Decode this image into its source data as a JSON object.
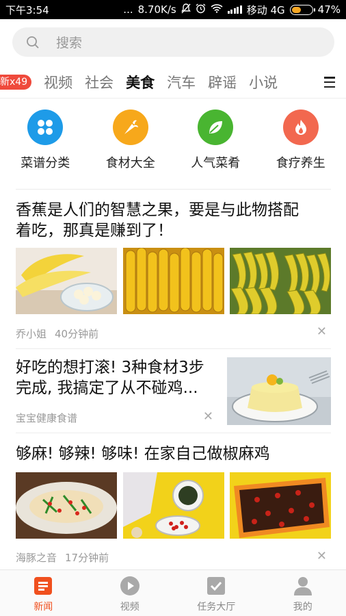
{
  "status_bar": {
    "time": "下午3:54",
    "dots": "...",
    "speed": "8.70K/s",
    "carrier": "移动 4G",
    "battery_text": "47%",
    "battery_level": 0.47
  },
  "search": {
    "placeholder": "搜索"
  },
  "tabs": {
    "badge": "新x49",
    "items": [
      "视频",
      "社会",
      "美食",
      "汽车",
      "辟谣",
      "小说"
    ],
    "active": "美食"
  },
  "categories": [
    {
      "label": "菜谱分类",
      "icon": "clover-icon",
      "color": "#1e9be8"
    },
    {
      "label": "食材大全",
      "icon": "carrot-icon",
      "color": "#f7a81b"
    },
    {
      "label": "人气菜肴",
      "icon": "leaf-icon",
      "color": "#49b531"
    },
    {
      "label": "食疗养生",
      "icon": "flame-icon",
      "color": "#f2684f"
    }
  ],
  "articles": [
    {
      "title_line1": "香蕉是人们的智慧之果，要是与此物搭配",
      "title_line2": "着吃，那真是赚到了！",
      "source": "乔小姐",
      "time": "40分钟前"
    },
    {
      "title_line1": "好吃的想打滚! 3种食材3步",
      "title_line2": "完成, 我搞定了从不碰鸡...",
      "source": "宝宝健康食谱",
      "time": ""
    },
    {
      "title_line1": "够麻! 够辣! 够味! 在家自己做椒麻鸡",
      "source": "海豚之音",
      "time": "17分钟前"
    }
  ],
  "bottom_nav": [
    {
      "label": "新闻",
      "icon": "news-icon",
      "active": true
    },
    {
      "label": "视频",
      "icon": "play-icon",
      "active": false
    },
    {
      "label": "任务大厅",
      "icon": "task-check-icon",
      "active": false
    },
    {
      "label": "我的",
      "icon": "profile-icon",
      "active": false
    }
  ],
  "colors": {
    "accent": "#f0501e",
    "badge": "#ef4a3c"
  }
}
